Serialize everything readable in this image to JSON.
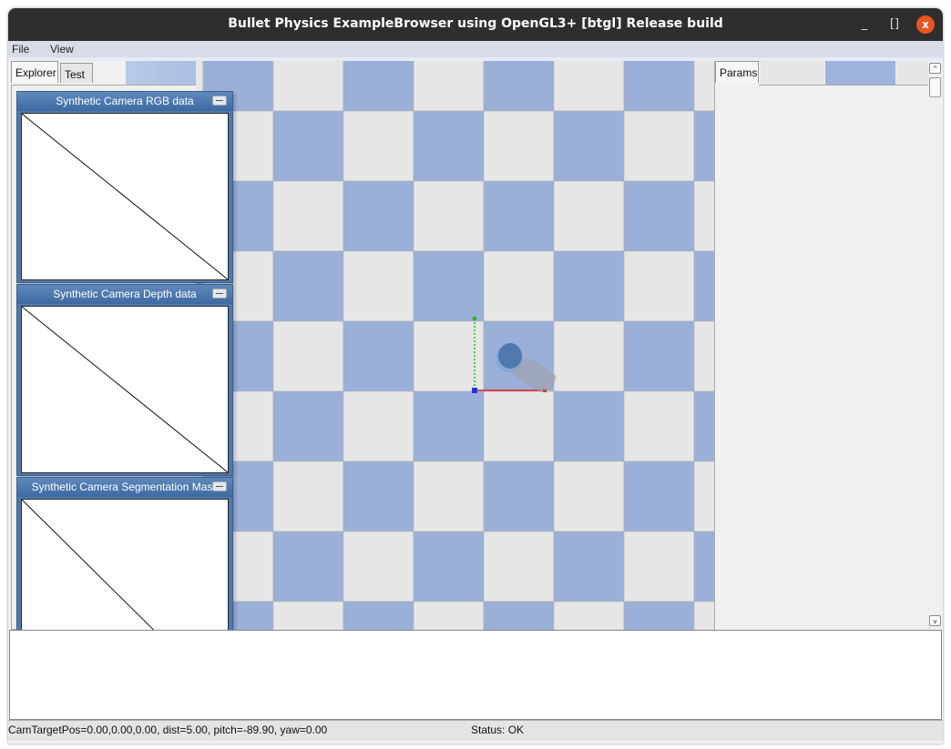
{
  "window": {
    "title": "Bullet Physics ExampleBrowser using OpenGL3+ [btgl] Release build",
    "minimize_icon": "minimize-icon",
    "maximize_icon": "maximize-icon",
    "close_icon": "close-icon",
    "minimize_glyph": "_",
    "maximize_glyph": "[]",
    "close_glyph": "x"
  },
  "menu": {
    "file": "File",
    "view": "View"
  },
  "tabs": {
    "explorer": "Explorer",
    "test": "Test",
    "params": "Params"
  },
  "camera_windows": [
    {
      "title": "Synthetic Camera RGB data"
    },
    {
      "title": "Synthetic Camera Depth data"
    },
    {
      "title": "Synthetic Camera Segmentation Mask"
    }
  ],
  "scene": {
    "checker_light": "#e6e6e6",
    "checker_blue": "#9bb0d8",
    "object_color": "#4f79ad",
    "axis_x_color": "#dd2222",
    "axis_y_color": "#22bb22",
    "axis_z_color": "#2233dd"
  },
  "scrollbar": {
    "up_glyph": "^",
    "down_glyph": "v"
  },
  "status": {
    "camera": "CamTargetPos=0.00,0.00,0.00, dist=5.00, pitch=-89.90, yaw=0.00",
    "state": "Status: OK"
  }
}
